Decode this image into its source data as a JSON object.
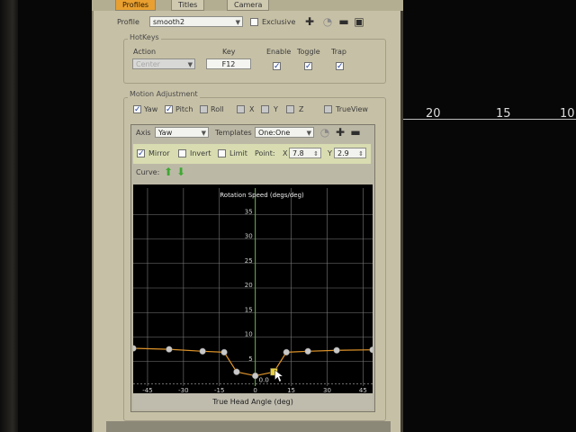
{
  "tabs": [
    "Profiles",
    "Titles",
    "Camera"
  ],
  "profile": {
    "label": "Profile",
    "value": "smooth2",
    "exclusive_label": "Exclusive",
    "exclusive_checked": false
  },
  "hotkeys": {
    "title": "HotKeys",
    "action_header": "Action",
    "key_header": "Key",
    "enable_header": "Enable",
    "toggle_header": "Toggle",
    "trap_header": "Trap",
    "action_value": "Center",
    "key_value": "F12",
    "enable": true,
    "toggle": true,
    "trap": true
  },
  "motion": {
    "title": "Motion Adjustment",
    "axes": [
      {
        "label": "Yaw",
        "checked": true
      },
      {
        "label": "Pitch",
        "checked": true
      },
      {
        "label": "Roll",
        "checked": false
      },
      {
        "label": "X",
        "checked": false
      },
      {
        "label": "Y",
        "checked": false
      },
      {
        "label": "Z",
        "checked": false
      },
      {
        "label": "TrueView",
        "checked": false
      }
    ]
  },
  "curve_editor": {
    "axis_label": "Axis",
    "axis_value": "Yaw",
    "templates_label": "Templates",
    "templates_value": "One:One",
    "mirror_label": "Mirror",
    "mirror": true,
    "invert_label": "Invert",
    "invert": false,
    "limit_label": "Limit",
    "limit": false,
    "point_label": "Point:",
    "x_label": "X",
    "x_value": "7.8",
    "y_label": "Y",
    "y_value": "2.9",
    "curve_label": "Curve:"
  },
  "background": {
    "numbers": [
      "20",
      "15",
      "10"
    ]
  },
  "chart_data": {
    "type": "line",
    "title": "Rotation Speed (degs/deg)",
    "xlabel": "True Head Angle (deg)",
    "ylabel": "Rotation Speed (degs/deg)",
    "xlim": [
      -51,
      49
    ],
    "ylim": [
      0,
      40
    ],
    "xticks": [
      -45,
      -30,
      -15,
      0,
      15,
      30,
      45
    ],
    "yticks": [
      5,
      10,
      15,
      20,
      25,
      30,
      35
    ],
    "grid": true,
    "annotations": [
      "0.0"
    ],
    "points": [
      {
        "x": -51,
        "y": 7.7
      },
      {
        "x": -36,
        "y": 7.5
      },
      {
        "x": -22,
        "y": 7.1
      },
      {
        "x": -13,
        "y": 6.9
      },
      {
        "x": -7.8,
        "y": 2.9
      },
      {
        "x": 0,
        "y": 2.1
      },
      {
        "x": 7.8,
        "y": 2.9
      },
      {
        "x": 13,
        "y": 6.9
      },
      {
        "x": 22,
        "y": 7.1
      },
      {
        "x": 34,
        "y": 7.3
      },
      {
        "x": 49,
        "y": 7.4
      }
    ],
    "selected_x": 7.8,
    "colors": {
      "curve": "#e0952a",
      "point": "#c8c8c8",
      "selected": "#e8d040",
      "grid": "#7b7b7b",
      "axis_y": "#6ab04c"
    }
  }
}
